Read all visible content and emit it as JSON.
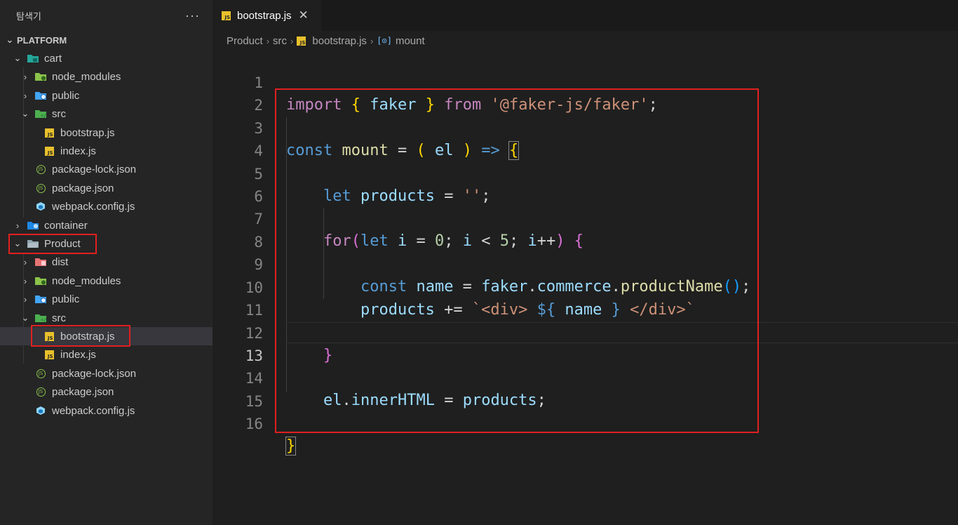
{
  "explorer": {
    "title": "탐색기",
    "more_label": "···",
    "root": "PLATFORM",
    "items": [
      {
        "label": "cart"
      },
      {
        "label": "node_modules"
      },
      {
        "label": "public"
      },
      {
        "label": "src"
      },
      {
        "label": "bootstrap.js"
      },
      {
        "label": "index.js"
      },
      {
        "label": "package-lock.json"
      },
      {
        "label": "package.json"
      },
      {
        "label": "webpack.config.js"
      },
      {
        "label": "container"
      },
      {
        "label": "Product"
      },
      {
        "label": "dist"
      },
      {
        "label": "node_modules"
      },
      {
        "label": "public"
      },
      {
        "label": "src"
      },
      {
        "label": "bootstrap.js"
      },
      {
        "label": "index.js"
      },
      {
        "label": "package-lock.json"
      },
      {
        "label": "package.json"
      },
      {
        "label": "webpack.config.js"
      }
    ]
  },
  "tab": {
    "label": "bootstrap.js",
    "close": "✕",
    "icon_text": "JS"
  },
  "breadcrumb": {
    "items": [
      "Product",
      "src",
      "bootstrap.js",
      "mount"
    ],
    "separator": "›"
  },
  "editor": {
    "line_numbers": [
      "1",
      "2",
      "3",
      "4",
      "5",
      "6",
      "7",
      "8",
      "9",
      "10",
      "11",
      "12",
      "13",
      "14",
      "15",
      "16"
    ],
    "active_line": "13"
  },
  "colors": {
    "highlight_box": "#e02020",
    "keyword": "#569cd6",
    "control": "#c586c0",
    "string": "#ce9178",
    "number": "#b5cea8",
    "variable": "#9cdcfe",
    "function": "#dcdcaa"
  }
}
